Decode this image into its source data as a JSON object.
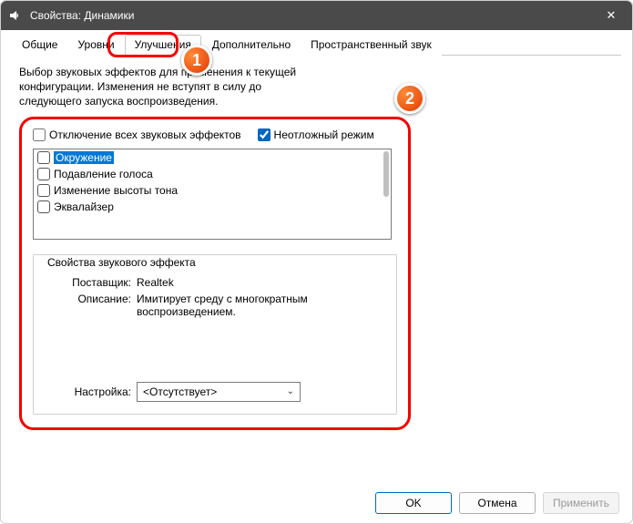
{
  "window": {
    "title": "Свойства: Динамики",
    "close_label": "✕"
  },
  "tabs": {
    "t0": "Общие",
    "t1": "Уровни",
    "t2": "Улучшения",
    "t3": "Дополнительно",
    "t4": "Пространственный звук"
  },
  "desc": "Выбор звуковых эффектов для применения к текущей конфигурации. Изменения не вступят в силу до следующего запуска воспроизведения.",
  "options": {
    "disable_all": "Отключение всех звуковых эффектов",
    "immediate": "Неотложный режим"
  },
  "effects": {
    "e0": "Окружение",
    "e1": "Подавление голоса",
    "e2": "Изменение высоты тона",
    "e3": "Эквалайзер"
  },
  "group": {
    "title": "Свойства звукового эффекта",
    "vendor_label": "Поставщик:",
    "vendor_value": "Realtek",
    "desc_label": "Описание:",
    "desc_value": "Имитирует среду с многократным воспроизведением.",
    "setting_label": "Настройка:",
    "setting_value": "<Отсутствует>"
  },
  "buttons": {
    "ok": "OK",
    "cancel": "Отмена",
    "apply": "Применить"
  },
  "callouts": {
    "c1": "1",
    "c2": "2"
  }
}
